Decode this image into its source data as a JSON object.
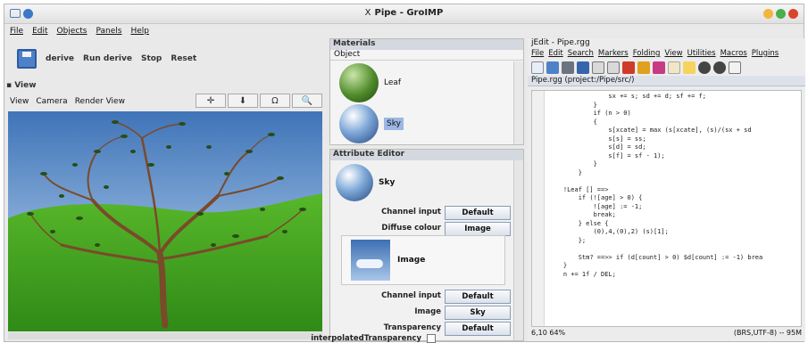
{
  "window": {
    "title": "Pipe - GroIMP",
    "title_glyph": "X"
  },
  "menubar": [
    "File",
    "Edit",
    "Objects",
    "Panels",
    "Help"
  ],
  "toolbar": {
    "items": [
      "derive",
      "Run derive",
      "Stop",
      "Reset"
    ]
  },
  "view": {
    "header": "View",
    "menu": [
      "View",
      "Camera",
      "Render View"
    ],
    "tools": [
      "✛",
      "⬇",
      "Ω",
      "🔍"
    ]
  },
  "materials": {
    "title": "Materials",
    "header": "Object",
    "items": [
      "Leaf",
      "Sky"
    ]
  },
  "attribute_editor": {
    "title": "Attribute Editor",
    "object_name": "Sky",
    "rows": [
      {
        "label": "Channel input",
        "value": "Default"
      },
      {
        "label": "Diffuse colour",
        "value": "Image"
      }
    ],
    "image_label": "Image",
    "rows2": [
      {
        "label": "Channel input",
        "value": "Default"
      },
      {
        "label": "Image",
        "value": "Sky"
      },
      {
        "label": "Transparency",
        "value": "Default"
      },
      {
        "label": "interpolatedTransparency",
        "value": ""
      }
    ]
  },
  "jedit": {
    "title": "jEdit - Pipe.rgg",
    "menu": [
      "File",
      "Edit",
      "Search",
      "Markers",
      "Folding",
      "View",
      "Utilities",
      "Macros",
      "Plugins",
      "Help"
    ],
    "tab": "Pipe.rgg (project:/Pipe/src/)",
    "code_lines": [
      "                sx += s; sd += d; sf += f;",
      "            }",
      "            if (n > 0)",
      "            {",
      "                s[xcate] = max (s[xcate], (s)/(sx + sd",
      "                s[s] = ss;",
      "                s[d] = sd;",
      "                s[f] = sf - 1);",
      "            }",
      "        }",
      "",
      "    !Leaf [] ==>",
      "        if (![age] > 0) {",
      "            ![age] := -1;",
      "            break;",
      "        } else {",
      "            (0),4,(0),2) (s)[1];",
      "        };",
      "",
      "        Stm? ==>> if (d[count] > 0) $d[count] := -1) brea",
      "    }",
      "    n += 1f / DEL;"
    ],
    "status_left": "6,10 64%",
    "status_right": "(BRS,UTF-8) -- 95M"
  }
}
